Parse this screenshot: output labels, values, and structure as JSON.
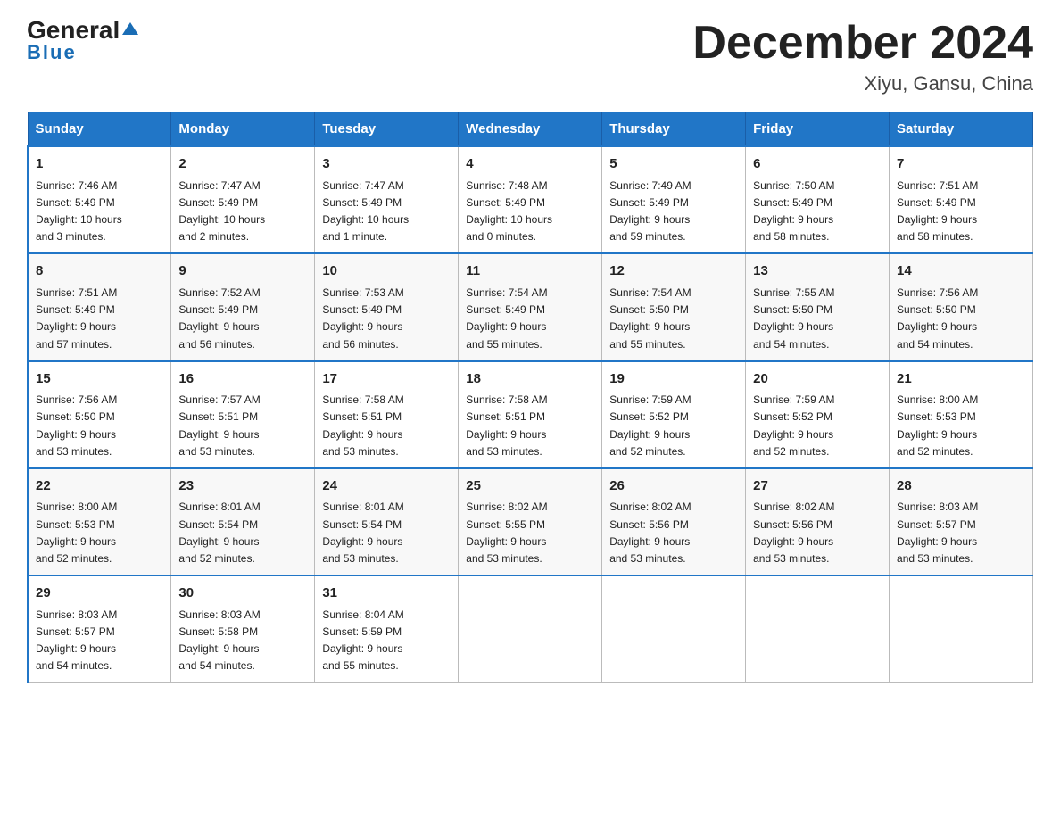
{
  "logo": {
    "general": "General",
    "blue": "Blue",
    "triangle": "▲"
  },
  "title": "December 2024",
  "subtitle": "Xiyu, Gansu, China",
  "weekdays": [
    "Sunday",
    "Monday",
    "Tuesday",
    "Wednesday",
    "Thursday",
    "Friday",
    "Saturday"
  ],
  "weeks": [
    [
      {
        "day": "1",
        "sunrise": "7:46 AM",
        "sunset": "5:49 PM",
        "daylight": "10 hours",
        "minutes": "and 3 minutes."
      },
      {
        "day": "2",
        "sunrise": "7:47 AM",
        "sunset": "5:49 PM",
        "daylight": "10 hours",
        "minutes": "and 2 minutes."
      },
      {
        "day": "3",
        "sunrise": "7:47 AM",
        "sunset": "5:49 PM",
        "daylight": "10 hours",
        "minutes": "and 1 minute."
      },
      {
        "day": "4",
        "sunrise": "7:48 AM",
        "sunset": "5:49 PM",
        "daylight": "10 hours",
        "minutes": "and 0 minutes."
      },
      {
        "day": "5",
        "sunrise": "7:49 AM",
        "sunset": "5:49 PM",
        "daylight": "9 hours",
        "minutes": "and 59 minutes."
      },
      {
        "day": "6",
        "sunrise": "7:50 AM",
        "sunset": "5:49 PM",
        "daylight": "9 hours",
        "minutes": "and 58 minutes."
      },
      {
        "day": "7",
        "sunrise": "7:51 AM",
        "sunset": "5:49 PM",
        "daylight": "9 hours",
        "minutes": "and 58 minutes."
      }
    ],
    [
      {
        "day": "8",
        "sunrise": "7:51 AM",
        "sunset": "5:49 PM",
        "daylight": "9 hours",
        "minutes": "and 57 minutes."
      },
      {
        "day": "9",
        "sunrise": "7:52 AM",
        "sunset": "5:49 PM",
        "daylight": "9 hours",
        "minutes": "and 56 minutes."
      },
      {
        "day": "10",
        "sunrise": "7:53 AM",
        "sunset": "5:49 PM",
        "daylight": "9 hours",
        "minutes": "and 56 minutes."
      },
      {
        "day": "11",
        "sunrise": "7:54 AM",
        "sunset": "5:49 PM",
        "daylight": "9 hours",
        "minutes": "and 55 minutes."
      },
      {
        "day": "12",
        "sunrise": "7:54 AM",
        "sunset": "5:50 PM",
        "daylight": "9 hours",
        "minutes": "and 55 minutes."
      },
      {
        "day": "13",
        "sunrise": "7:55 AM",
        "sunset": "5:50 PM",
        "daylight": "9 hours",
        "minutes": "and 54 minutes."
      },
      {
        "day": "14",
        "sunrise": "7:56 AM",
        "sunset": "5:50 PM",
        "daylight": "9 hours",
        "minutes": "and 54 minutes."
      }
    ],
    [
      {
        "day": "15",
        "sunrise": "7:56 AM",
        "sunset": "5:50 PM",
        "daylight": "9 hours",
        "minutes": "and 53 minutes."
      },
      {
        "day": "16",
        "sunrise": "7:57 AM",
        "sunset": "5:51 PM",
        "daylight": "9 hours",
        "minutes": "and 53 minutes."
      },
      {
        "day": "17",
        "sunrise": "7:58 AM",
        "sunset": "5:51 PM",
        "daylight": "9 hours",
        "minutes": "and 53 minutes."
      },
      {
        "day": "18",
        "sunrise": "7:58 AM",
        "sunset": "5:51 PM",
        "daylight": "9 hours",
        "minutes": "and 53 minutes."
      },
      {
        "day": "19",
        "sunrise": "7:59 AM",
        "sunset": "5:52 PM",
        "daylight": "9 hours",
        "minutes": "and 52 minutes."
      },
      {
        "day": "20",
        "sunrise": "7:59 AM",
        "sunset": "5:52 PM",
        "daylight": "9 hours",
        "minutes": "and 52 minutes."
      },
      {
        "day": "21",
        "sunrise": "8:00 AM",
        "sunset": "5:53 PM",
        "daylight": "9 hours",
        "minutes": "and 52 minutes."
      }
    ],
    [
      {
        "day": "22",
        "sunrise": "8:00 AM",
        "sunset": "5:53 PM",
        "daylight": "9 hours",
        "minutes": "and 52 minutes."
      },
      {
        "day": "23",
        "sunrise": "8:01 AM",
        "sunset": "5:54 PM",
        "daylight": "9 hours",
        "minutes": "and 52 minutes."
      },
      {
        "day": "24",
        "sunrise": "8:01 AM",
        "sunset": "5:54 PM",
        "daylight": "9 hours",
        "minutes": "and 53 minutes."
      },
      {
        "day": "25",
        "sunrise": "8:02 AM",
        "sunset": "5:55 PM",
        "daylight": "9 hours",
        "minutes": "and 53 minutes."
      },
      {
        "day": "26",
        "sunrise": "8:02 AM",
        "sunset": "5:56 PM",
        "daylight": "9 hours",
        "minutes": "and 53 minutes."
      },
      {
        "day": "27",
        "sunrise": "8:02 AM",
        "sunset": "5:56 PM",
        "daylight": "9 hours",
        "minutes": "and 53 minutes."
      },
      {
        "day": "28",
        "sunrise": "8:03 AM",
        "sunset": "5:57 PM",
        "daylight": "9 hours",
        "minutes": "and 53 minutes."
      }
    ],
    [
      {
        "day": "29",
        "sunrise": "8:03 AM",
        "sunset": "5:57 PM",
        "daylight": "9 hours",
        "minutes": "and 54 minutes."
      },
      {
        "day": "30",
        "sunrise": "8:03 AM",
        "sunset": "5:58 PM",
        "daylight": "9 hours",
        "minutes": "and 54 minutes."
      },
      {
        "day": "31",
        "sunrise": "8:04 AM",
        "sunset": "5:59 PM",
        "daylight": "9 hours",
        "minutes": "and 55 minutes."
      },
      null,
      null,
      null,
      null
    ]
  ]
}
